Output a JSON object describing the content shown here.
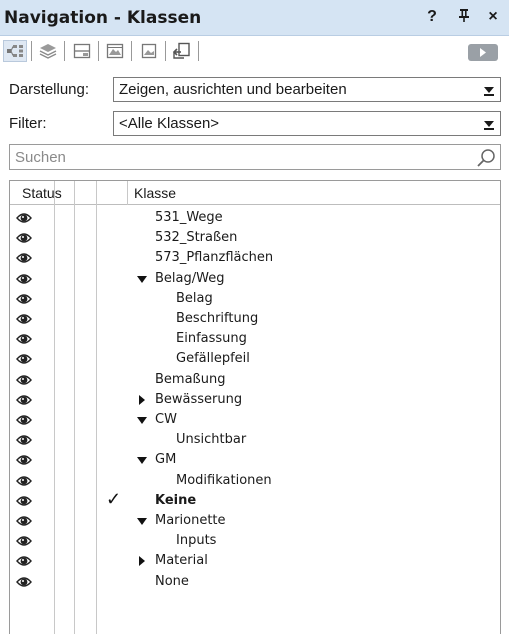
{
  "window": {
    "title": "Navigation - Klassen",
    "help": "?",
    "pin": "ᵻ",
    "close": "×"
  },
  "toolbar": {
    "tools": [
      {
        "name": "classes-view",
        "selected": true
      },
      {
        "name": "layers-view",
        "selected": false
      },
      {
        "name": "sheet-layers-view",
        "selected": false
      },
      {
        "name": "viewports-view",
        "selected": false
      },
      {
        "name": "saved-views-view",
        "selected": false
      },
      {
        "name": "references-view",
        "selected": false
      }
    ]
  },
  "display": {
    "label": "Darstellung:",
    "value": "Zeigen, ausrichten und bearbeiten"
  },
  "filter": {
    "label": "Filter:",
    "value": "<Alle Klassen>"
  },
  "search": {
    "placeholder": "Suchen"
  },
  "table": {
    "columns": {
      "status": "Status",
      "class": "Klasse"
    },
    "rows": [
      {
        "label": "531_Wege",
        "level": 1,
        "expander": "none",
        "active": false
      },
      {
        "label": "532_Straßen",
        "level": 1,
        "expander": "none",
        "active": false
      },
      {
        "label": "573_Pflanzflächen",
        "level": 1,
        "expander": "none",
        "active": false
      },
      {
        "label": "Belag/Weg",
        "level": 1,
        "expander": "expanded",
        "active": false
      },
      {
        "label": "Belag",
        "level": 2,
        "expander": "none",
        "active": false
      },
      {
        "label": "Beschriftung",
        "level": 2,
        "expander": "none",
        "active": false
      },
      {
        "label": "Einfassung",
        "level": 2,
        "expander": "none",
        "active": false
      },
      {
        "label": "Gefällepfeil",
        "level": 2,
        "expander": "none",
        "active": false
      },
      {
        "label": "Bemaßung",
        "level": 1,
        "expander": "none",
        "active": false
      },
      {
        "label": "Bewässerung",
        "level": 1,
        "expander": "collapsed",
        "active": false
      },
      {
        "label": "CW",
        "level": 1,
        "expander": "expanded",
        "active": false
      },
      {
        "label": "Unsichtbar",
        "level": 2,
        "expander": "none",
        "active": false
      },
      {
        "label": "GM",
        "level": 1,
        "expander": "expanded",
        "active": false
      },
      {
        "label": "Modifikationen",
        "level": 2,
        "expander": "none",
        "active": false
      },
      {
        "label": "Keine",
        "level": 1,
        "expander": "none",
        "active": true
      },
      {
        "label": "Marionette",
        "level": 1,
        "expander": "expanded",
        "active": false
      },
      {
        "label": "Inputs",
        "level": 2,
        "expander": "none",
        "active": false
      },
      {
        "label": "Material",
        "level": 1,
        "expander": "collapsed",
        "active": false
      },
      {
        "label": "None",
        "level": 1,
        "expander": "none",
        "active": false
      }
    ],
    "active_mark": "✓"
  },
  "icons": {
    "visibility": "eye-icon",
    "search": "magnifier-icon",
    "expand": "triangle-down-icon",
    "collapse": "triangle-right-icon"
  },
  "colors": {
    "titlebar": "#d5e4f3",
    "play_button": "#9aa0a6"
  }
}
